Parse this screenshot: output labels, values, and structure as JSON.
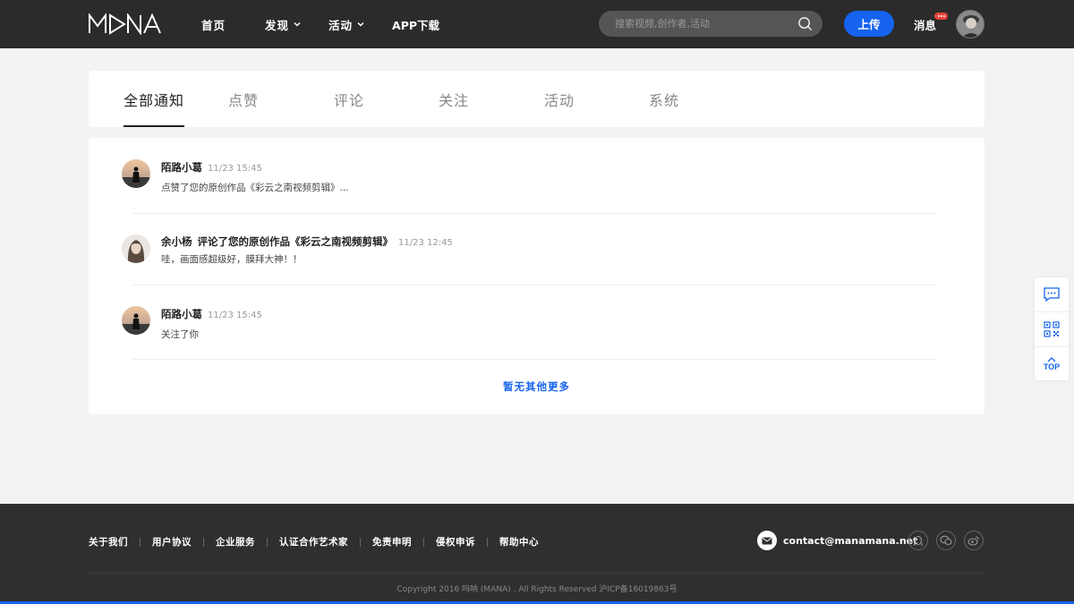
{
  "header": {
    "logo": "MANA",
    "nav": [
      {
        "label": "首页",
        "has_dropdown": false
      },
      {
        "label": "发现",
        "has_dropdown": true
      },
      {
        "label": "活动",
        "has_dropdown": true
      },
      {
        "label": "APP下载",
        "has_dropdown": false
      }
    ],
    "search_placeholder": "搜索视频,创作者,活动",
    "upload_label": "上传",
    "messages_label": "消息"
  },
  "tabs": [
    {
      "label": "全部通知",
      "active": true
    },
    {
      "label": "点赞",
      "active": false
    },
    {
      "label": "评论",
      "active": false
    },
    {
      "label": "关注",
      "active": false
    },
    {
      "label": "活动",
      "active": false
    },
    {
      "label": "系统",
      "active": false
    }
  ],
  "notifications": [
    {
      "user": "陌路小葛",
      "action": "",
      "time": "11/23  15:45",
      "body": "点赞了您的原创作品《彩云之南视频剪辑》..."
    },
    {
      "user": "余小杨",
      "action": "评论了您的原创作品《彩云之南视频剪辑》",
      "time": "11/23  12:45",
      "body": "哇，画面感超级好，膜拜大神！！"
    },
    {
      "user": "陌路小葛",
      "action": "",
      "time": "11/23  15:45",
      "body": "关注了你"
    }
  ],
  "no_more_label": "暂无其他更多",
  "side": {
    "top_label": "TOP"
  },
  "footer": {
    "links": [
      "关于我们",
      "用户协议",
      "企业服务",
      "认证合作艺术家",
      "免责申明",
      "侵权申诉",
      "帮助中心"
    ],
    "email": "contact@manamana.net",
    "copyright": "Copyright 2016 吗呐 (MANA) . All Rights Reserved  沪ICP备16019863号"
  },
  "colors": {
    "accent": "#1563ee",
    "header_bg": "#2b2b2b",
    "footer_bg": "#2f2f2f",
    "badge": "#e8453c"
  }
}
